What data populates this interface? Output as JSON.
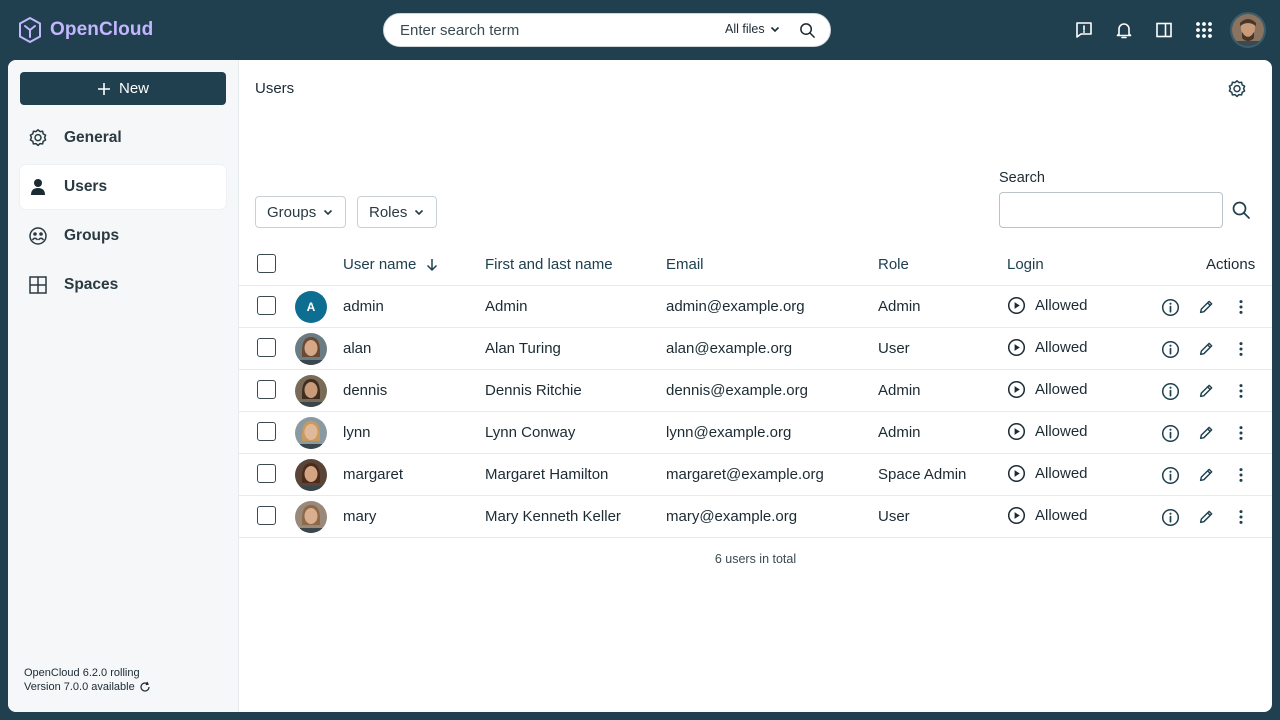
{
  "app": {
    "name": "OpenCloud"
  },
  "search": {
    "placeholder": "Enter search term",
    "scope": "All files"
  },
  "sidebar": {
    "new_label": "New",
    "items": [
      {
        "label": "General",
        "icon": "gear-icon"
      },
      {
        "label": "Users",
        "icon": "user-icon",
        "active": true
      },
      {
        "label": "Groups",
        "icon": "groups-icon"
      },
      {
        "label": "Spaces",
        "icon": "spaces-grid-icon"
      }
    ],
    "version_line1": "OpenCloud 6.2.0 rolling",
    "version_line2": "Version 7.0.0 available"
  },
  "main": {
    "title": "Users",
    "filters": {
      "groups": "Groups",
      "roles": "Roles"
    },
    "search_label": "Search",
    "columns": {
      "user_name": "User name",
      "full_name": "First and last name",
      "email": "Email",
      "role": "Role",
      "login": "Login",
      "actions": "Actions"
    },
    "rows": [
      {
        "username": "admin",
        "name": "Admin",
        "email": "admin@example.org",
        "role": "Admin",
        "login": "Allowed",
        "avatar_letter": "A"
      },
      {
        "username": "alan",
        "name": "Alan Turing",
        "email": "alan@example.org",
        "role": "User",
        "login": "Allowed"
      },
      {
        "username": "dennis",
        "name": "Dennis Ritchie",
        "email": "dennis@example.org",
        "role": "Admin",
        "login": "Allowed"
      },
      {
        "username": "lynn",
        "name": "Lynn Conway",
        "email": "lynn@example.org",
        "role": "Admin",
        "login": "Allowed"
      },
      {
        "username": "margaret",
        "name": "Margaret Hamilton",
        "email": "margaret@example.org",
        "role": "Space Admin",
        "login": "Allowed"
      },
      {
        "username": "mary",
        "name": "Mary Kenneth Keller",
        "email": "mary@example.org",
        "role": "User",
        "login": "Allowed"
      }
    ],
    "total": "6 users in total"
  },
  "colors": {
    "topbar": "#20404f",
    "accent": "#0d6e91",
    "logo": "#c4b5ff"
  }
}
